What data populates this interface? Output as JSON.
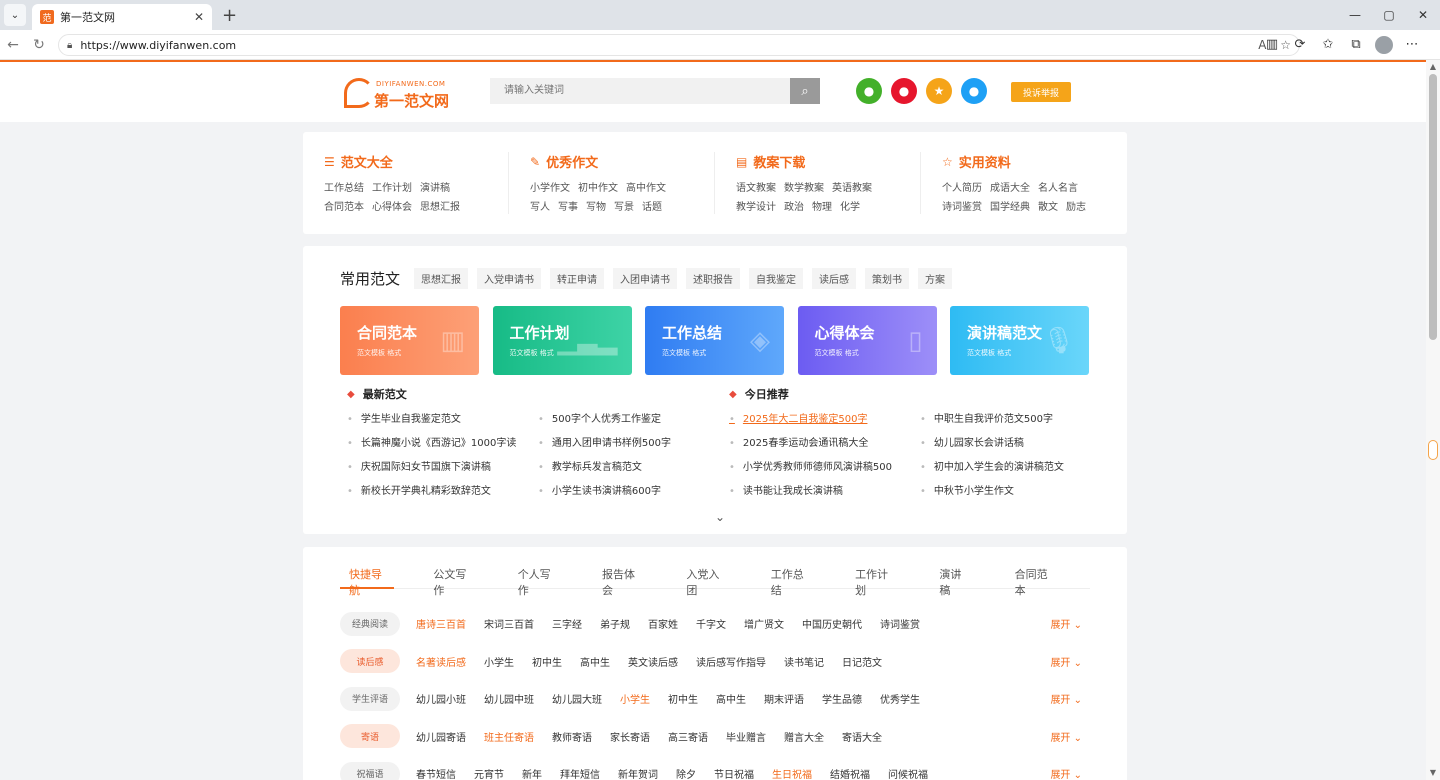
{
  "browser": {
    "tab_title": "第一范文网",
    "tab_favicon": "范",
    "url": "https://www.diyifanwen.com",
    "win_min": "—",
    "win_max": "▢",
    "win_close": "✕"
  },
  "header": {
    "logo_en": "DIYIFANWEN.COM",
    "logo_cn": "第一范文网",
    "search_placeholder": "请输入关键词",
    "report_label": "投诉举报"
  },
  "categories": [
    {
      "title": "范文大全",
      "icon": "list-icon",
      "links": [
        "工作总结",
        "工作计划",
        "演讲稿",
        "合同范本",
        "心得体会",
        "思想汇报"
      ]
    },
    {
      "title": "优秀作文",
      "icon": "edit-icon",
      "links": [
        "小学作文",
        "初中作文",
        "高中作文",
        "写人",
        "写事",
        "写物",
        "写景",
        "话题"
      ]
    },
    {
      "title": "教案下载",
      "icon": "doc-icon",
      "links": [
        "语文教案",
        "数学教案",
        "英语教案",
        "教学设计",
        "政治",
        "物理",
        "化学"
      ]
    },
    {
      "title": "实用资料",
      "icon": "star-icon",
      "links": [
        "个人简历",
        "成语大全",
        "名人名言",
        "诗词鉴赏",
        "国学经典",
        "散文",
        "励志"
      ]
    }
  ],
  "common": {
    "title": "常用范文",
    "tags": [
      "思想汇报",
      "入党申请书",
      "转正申请",
      "入团申请书",
      "述职报告",
      "自我鉴定",
      "读后感",
      "策划书",
      "方案"
    ],
    "tiles": [
      {
        "title": "合同范本",
        "sub": "范文模板 格式",
        "color": "#fb8a5a"
      },
      {
        "title": "工作计划",
        "sub": "范文模板 格式",
        "color": "#22c28e"
      },
      {
        "title": "工作总结",
        "sub": "范文模板 格式",
        "color": "#3a8bf5"
      },
      {
        "title": "心得体会",
        "sub": "范文模板 格式",
        "color": "#7c6cf5"
      },
      {
        "title": "演讲稿范文",
        "sub": "范文模板 格式",
        "color": "#3dc6f5"
      }
    ],
    "latest": {
      "title": "最新范文",
      "col1": [
        "学生毕业自我鉴定范文",
        "长篇神魔小说《西游记》1000字读",
        "庆祝国际妇女节国旗下演讲稿",
        "新校长开学典礼精彩致辞范文"
      ],
      "col2": [
        "500字个人优秀工作鉴定",
        "通用入团申请书样例500字",
        "教学标兵发言稿范文",
        "小学生读书演讲稿600字"
      ]
    },
    "today": {
      "title": "今日推荐",
      "col1": [
        "2025年大二自我鉴定500字",
        "2025春季运动会通讯稿大全",
        "小学优秀教师师德师风演讲稿500",
        "读书能让我成长演讲稿"
      ],
      "col2": [
        "中职生自我评价范文500字",
        "幼儿园家长会讲话稿",
        "初中加入学生会的演讲稿范文",
        "中秋节小学生作文"
      ]
    }
  },
  "quicknav": {
    "tabs": [
      "快捷导航",
      "公文写作",
      "个人写作",
      "报告体会",
      "入党入团",
      "工作总结",
      "工作计划",
      "演讲稿",
      "合同范本"
    ],
    "expand_label": "展开",
    "rows": [
      {
        "label": "经典阅读",
        "hot": false,
        "links": [
          "唐诗三百首",
          "宋词三百首",
          "三字经",
          "弟子规",
          "百家姓",
          "千字文",
          "增广贤文",
          "中国历史朝代",
          "诗词鉴赏"
        ],
        "hl": [
          0
        ]
      },
      {
        "label": "读后感",
        "hot": true,
        "links": [
          "名著读后感",
          "小学生",
          "初中生",
          "高中生",
          "英文读后感",
          "读后感写作指导",
          "读书笔记",
          "日记范文"
        ],
        "hl": [
          0
        ]
      },
      {
        "label": "学生评语",
        "hot": false,
        "links": [
          "幼儿园小班",
          "幼儿园中班",
          "幼儿园大班",
          "小学生",
          "初中生",
          "高中生",
          "期末评语",
          "学生品德",
          "优秀学生"
        ],
        "hl": [
          3
        ]
      },
      {
        "label": "寄语",
        "hot": true,
        "links": [
          "幼儿园寄语",
          "班主任寄语",
          "教师寄语",
          "家长寄语",
          "高三寄语",
          "毕业赠言",
          "赠言大全",
          "寄语大全"
        ],
        "hl": [
          1
        ]
      },
      {
        "label": "祝福语",
        "hot": false,
        "links": [
          "春节短信",
          "元宵节",
          "新年",
          "拜年短信",
          "新年贺词",
          "除夕",
          "节日祝福",
          "生日祝福",
          "结婚祝福",
          "问候祝福"
        ],
        "hl": [
          7
        ]
      }
    ]
  },
  "colors": {
    "accent": "#f26a1b",
    "report": "#f5a419"
  }
}
